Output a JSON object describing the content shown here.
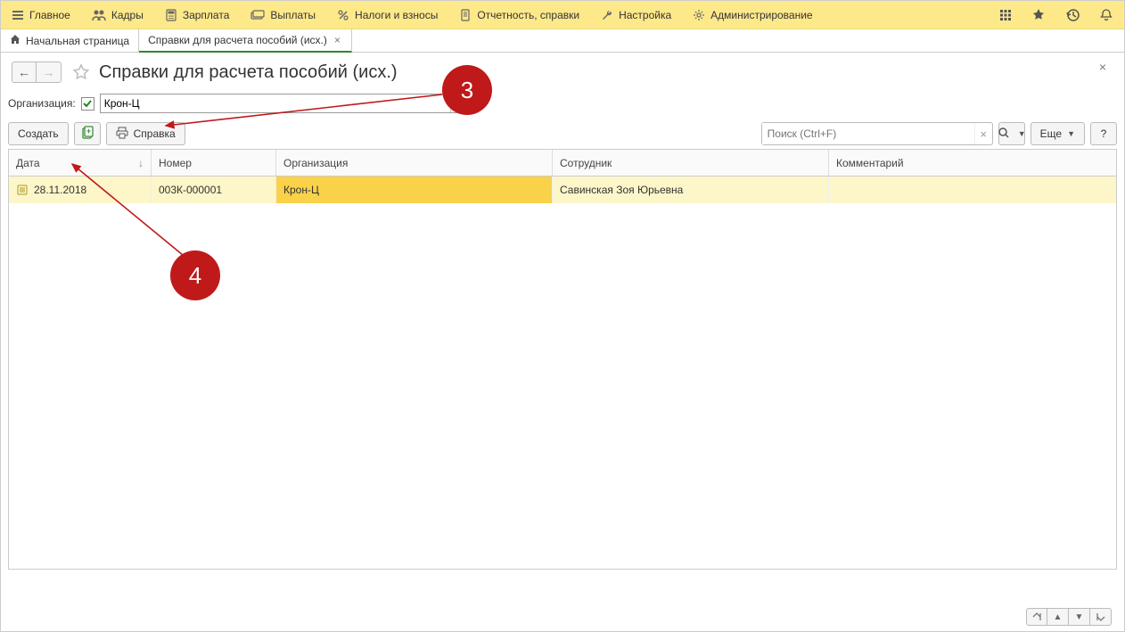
{
  "topmenu": {
    "items": [
      {
        "label": "Главное",
        "icon": "menu"
      },
      {
        "label": "Кадры",
        "icon": "people"
      },
      {
        "label": "Зарплата",
        "icon": "calc"
      },
      {
        "label": "Выплаты",
        "icon": "cards"
      },
      {
        "label": "Налоги и взносы",
        "icon": "percent"
      },
      {
        "label": "Отчетность, справки",
        "icon": "doc"
      },
      {
        "label": "Настройка",
        "icon": "wrench"
      },
      {
        "label": "Администрирование",
        "icon": "gear"
      }
    ]
  },
  "tabs": {
    "items": [
      {
        "label": "Начальная страница",
        "icon": "home",
        "closable": false
      },
      {
        "label": "Справки для расчета пособий (исх.)",
        "icon": "",
        "closable": true,
        "active": true
      }
    ]
  },
  "page": {
    "title": "Справки для расчета пособий (исх.)"
  },
  "filter": {
    "label": "Организация:",
    "checked": true,
    "value": "Крон-Ц"
  },
  "toolbar": {
    "create_label": "Создать",
    "print_label": "Справка",
    "search_placeholder": "Поиск (Ctrl+F)",
    "more_label": "Еще",
    "help_label": "?"
  },
  "table": {
    "columns": {
      "date": "Дата",
      "num": "Номер",
      "org": "Организация",
      "emp": "Сотрудник",
      "com": "Комментарий"
    },
    "rows": [
      {
        "date": "28.11.2018",
        "num": "003К-000001",
        "org": "Крон-Ц",
        "emp": "Савинская Зоя Юрьевна",
        "com": ""
      }
    ]
  },
  "annotations": {
    "b3": "3",
    "b4": "4"
  }
}
